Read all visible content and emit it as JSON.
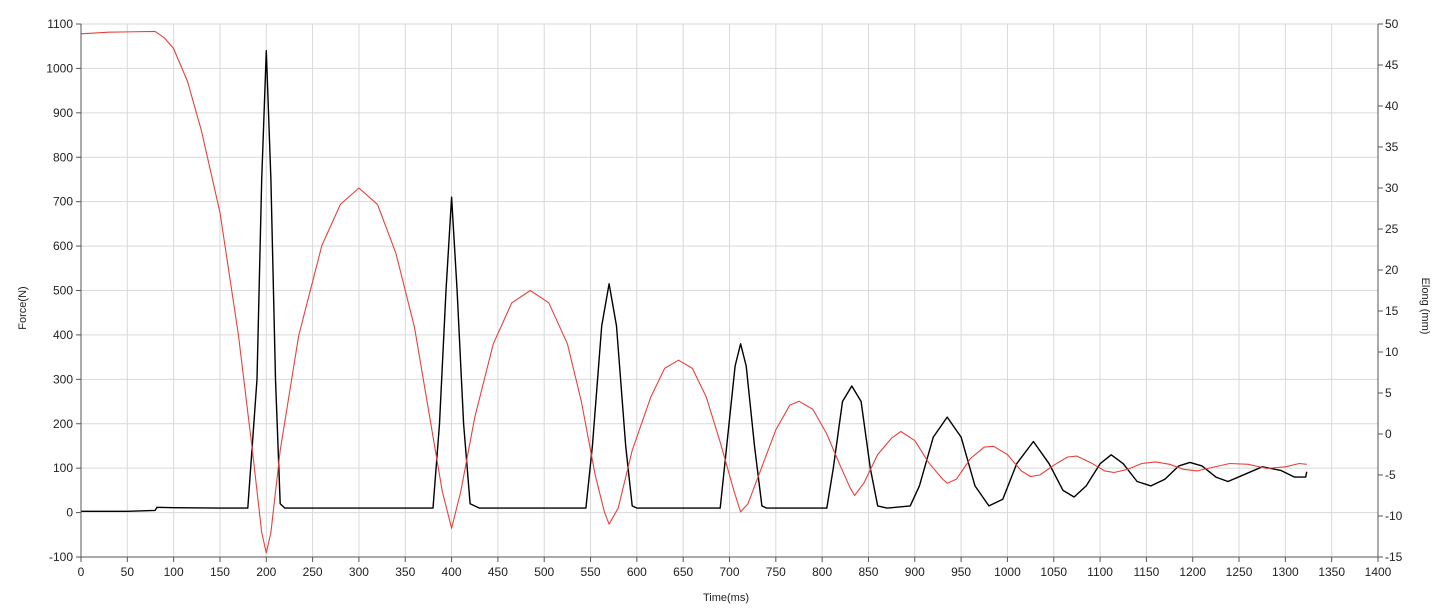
{
  "chart_data": {
    "type": "line",
    "xlabel": "Time(ms)",
    "ylabel_left": "Force(N)",
    "ylabel_right": "Elong (mm)",
    "xlim": [
      0,
      1400
    ],
    "ylim_left": [
      -100,
      1100
    ],
    "ylim_right": [
      -15,
      50
    ],
    "x_ticks": [
      0,
      50,
      100,
      150,
      200,
      250,
      300,
      350,
      400,
      450,
      500,
      550,
      600,
      650,
      700,
      750,
      800,
      850,
      900,
      950,
      1000,
      1050,
      1100,
      1150,
      1200,
      1250,
      1300,
      1350,
      1400
    ],
    "y_left_ticks": [
      -100,
      0,
      100,
      200,
      300,
      400,
      500,
      600,
      700,
      800,
      900,
      1000,
      1100
    ],
    "y_right_ticks": [
      -15,
      -10,
      -5,
      0,
      5,
      10,
      15,
      20,
      25,
      30,
      35,
      40,
      45,
      50
    ],
    "grid": true,
    "colors": {
      "force": "#000000",
      "elong": "#e8413c"
    },
    "series": [
      {
        "axis": "left",
        "color": "#000000",
        "points": [
          [
            0,
            3
          ],
          [
            50,
            3
          ],
          [
            80,
            5
          ],
          [
            82,
            12
          ],
          [
            100,
            11
          ],
          [
            150,
            10
          ],
          [
            180,
            10
          ],
          [
            190,
            300
          ],
          [
            195,
            750
          ],
          [
            200,
            1040
          ],
          [
            205,
            750
          ],
          [
            210,
            300
          ],
          [
            215,
            20
          ],
          [
            220,
            10
          ],
          [
            300,
            10
          ],
          [
            380,
            10
          ],
          [
            387,
            200
          ],
          [
            394,
            500
          ],
          [
            400,
            710
          ],
          [
            406,
            500
          ],
          [
            413,
            200
          ],
          [
            420,
            20
          ],
          [
            430,
            10
          ],
          [
            500,
            10
          ],
          [
            545,
            10
          ],
          [
            552,
            150
          ],
          [
            562,
            420
          ],
          [
            570,
            515
          ],
          [
            578,
            420
          ],
          [
            588,
            150
          ],
          [
            595,
            15
          ],
          [
            600,
            10
          ],
          [
            660,
            10
          ],
          [
            690,
            10
          ],
          [
            697,
            150
          ],
          [
            706,
            330
          ],
          [
            712,
            380
          ],
          [
            718,
            330
          ],
          [
            727,
            150
          ],
          [
            735,
            15
          ],
          [
            740,
            10
          ],
          [
            780,
            10
          ],
          [
            805,
            10
          ],
          [
            812,
            100
          ],
          [
            822,
            250
          ],
          [
            832,
            285
          ],
          [
            842,
            250
          ],
          [
            852,
            100
          ],
          [
            860,
            15
          ],
          [
            870,
            10
          ],
          [
            895,
            15
          ],
          [
            905,
            60
          ],
          [
            920,
            170
          ],
          [
            935,
            215
          ],
          [
            950,
            170
          ],
          [
            965,
            60
          ],
          [
            980,
            15
          ],
          [
            995,
            30
          ],
          [
            1010,
            110
          ],
          [
            1028,
            160
          ],
          [
            1045,
            110
          ],
          [
            1060,
            50
          ],
          [
            1072,
            35
          ],
          [
            1085,
            60
          ],
          [
            1100,
            110
          ],
          [
            1112,
            130
          ],
          [
            1125,
            110
          ],
          [
            1140,
            70
          ],
          [
            1155,
            60
          ],
          [
            1170,
            75
          ],
          [
            1185,
            105
          ],
          [
            1197,
            113
          ],
          [
            1210,
            105
          ],
          [
            1225,
            80
          ],
          [
            1238,
            70
          ],
          [
            1255,
            85
          ],
          [
            1275,
            103
          ],
          [
            1295,
            95
          ],
          [
            1310,
            80
          ],
          [
            1322,
            80
          ],
          [
            1323,
            92
          ]
        ]
      },
      {
        "axis": "right",
        "color": "#e8413c",
        "points": [
          [
            0,
            48.8
          ],
          [
            30,
            49
          ],
          [
            80,
            49.1
          ],
          [
            90,
            48.3
          ],
          [
            100,
            47
          ],
          [
            115,
            43
          ],
          [
            130,
            37
          ],
          [
            150,
            27
          ],
          [
            170,
            12
          ],
          [
            185,
            -2
          ],
          [
            195,
            -12
          ],
          [
            200,
            -14.5
          ],
          [
            205,
            -12
          ],
          [
            215,
            -2
          ],
          [
            235,
            12
          ],
          [
            260,
            23
          ],
          [
            280,
            28
          ],
          [
            300,
            30
          ],
          [
            320,
            28
          ],
          [
            340,
            22
          ],
          [
            360,
            13
          ],
          [
            375,
            3
          ],
          [
            390,
            -7
          ],
          [
            400,
            -11.5
          ],
          [
            410,
            -7
          ],
          [
            425,
            2
          ],
          [
            445,
            11
          ],
          [
            465,
            16
          ],
          [
            485,
            17.5
          ],
          [
            505,
            16
          ],
          [
            525,
            11
          ],
          [
            540,
            4
          ],
          [
            555,
            -5
          ],
          [
            565,
            -9.5
          ],
          [
            570,
            -11
          ],
          [
            580,
            -9
          ],
          [
            595,
            -2
          ],
          [
            615,
            4.5
          ],
          [
            630,
            8
          ],
          [
            645,
            9
          ],
          [
            660,
            8
          ],
          [
            675,
            4.5
          ],
          [
            690,
            -1
          ],
          [
            705,
            -7
          ],
          [
            712,
            -9.5
          ],
          [
            720,
            -8.5
          ],
          [
            735,
            -4
          ],
          [
            750,
            0.5
          ],
          [
            765,
            3.5
          ],
          [
            775,
            4
          ],
          [
            790,
            3
          ],
          [
            805,
            0
          ],
          [
            820,
            -4
          ],
          [
            830,
            -6.5
          ],
          [
            835,
            -7.5
          ],
          [
            845,
            -6
          ],
          [
            860,
            -2.5
          ],
          [
            875,
            -0.5
          ],
          [
            885,
            0.3
          ],
          [
            900,
            -0.8
          ],
          [
            915,
            -3.5
          ],
          [
            930,
            -5.5
          ],
          [
            935,
            -6
          ],
          [
            945,
            -5.5
          ],
          [
            960,
            -3
          ],
          [
            975,
            -1.6
          ],
          [
            985,
            -1.5
          ],
          [
            1000,
            -2.5
          ],
          [
            1015,
            -4.5
          ],
          [
            1025,
            -5.2
          ],
          [
            1035,
            -5
          ],
          [
            1050,
            -3.8
          ],
          [
            1065,
            -2.8
          ],
          [
            1075,
            -2.7
          ],
          [
            1090,
            -3.5
          ],
          [
            1105,
            -4.5
          ],
          [
            1115,
            -4.7
          ],
          [
            1130,
            -4.3
          ],
          [
            1145,
            -3.6
          ],
          [
            1160,
            -3.4
          ],
          [
            1175,
            -3.7
          ],
          [
            1190,
            -4.3
          ],
          [
            1205,
            -4.5
          ],
          [
            1220,
            -4.1
          ],
          [
            1240,
            -3.6
          ],
          [
            1260,
            -3.7
          ],
          [
            1280,
            -4.2
          ],
          [
            1300,
            -4
          ],
          [
            1315,
            -3.6
          ],
          [
            1323,
            -3.7
          ]
        ]
      }
    ]
  }
}
